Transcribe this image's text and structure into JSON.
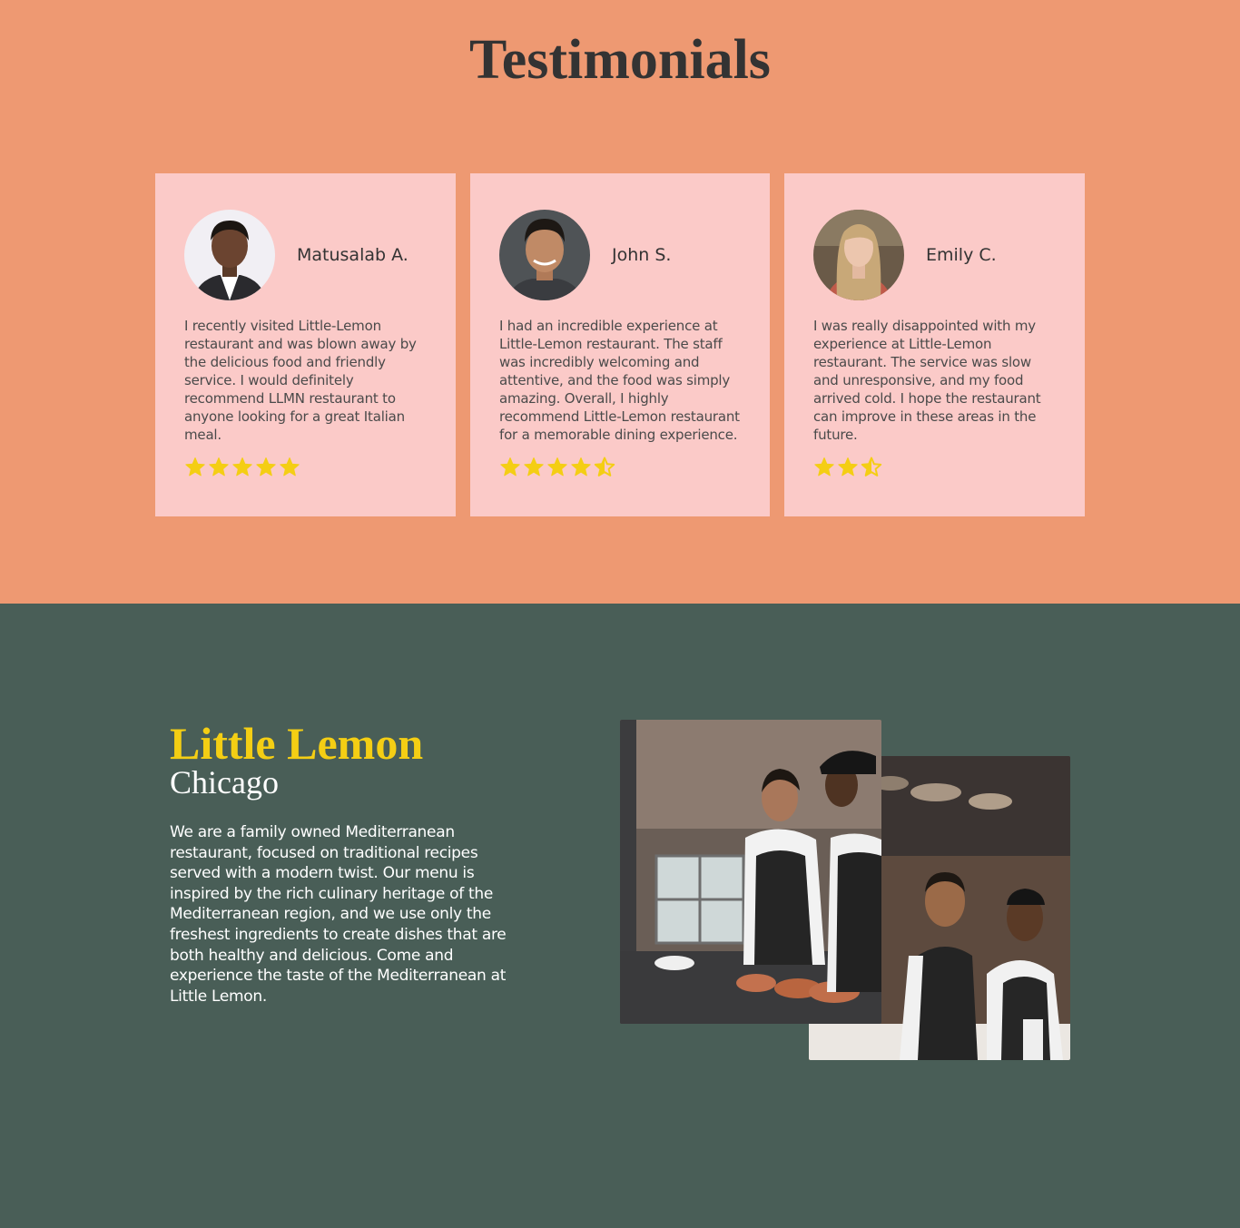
{
  "testimonials": {
    "title": "Testimonials",
    "cards": [
      {
        "name": "Matusalab A.",
        "review": "I recently visited Little-Lemon restaurant and was blown away by the delicious food and friendly service. I would definitely recommend LLMN restaurant to anyone looking for a great Italian meal.",
        "rating": 5
      },
      {
        "name": "John S.",
        "review": "I had an incredible experience at Little-Lemon restaurant. The staff was incredibly welcoming and attentive, and the food was simply amazing. Overall, I highly recommend Little-Lemon restaurant for a memorable dining experience.",
        "rating": 4.5
      },
      {
        "name": "Emily C.",
        "review": "I was really disappointed with my experience at Little-Lemon restaurant. The service was slow and unresponsive, and my food arrived cold. I hope the restaurant can improve in these areas in the future.",
        "rating": 2.5
      }
    ]
  },
  "about": {
    "title": "Little Lemon",
    "subtitle": "Chicago",
    "description": "We are a family owned Mediterranean restaurant, focused on traditional recipes served with a modern twist. Our menu is inspired by the rich culinary heritage of the Mediterranean region, and we use only the freshest ingredients to create dishes that are both healthy and delicious. Come and experience the taste of the Mediterranean at Little Lemon."
  },
  "colors": {
    "star": "#f4ce14",
    "testimonials_bg": "#ee9972",
    "card_bg": "#fbcac8",
    "about_bg": "#495e57",
    "brand_yellow": "#f4ce14"
  }
}
